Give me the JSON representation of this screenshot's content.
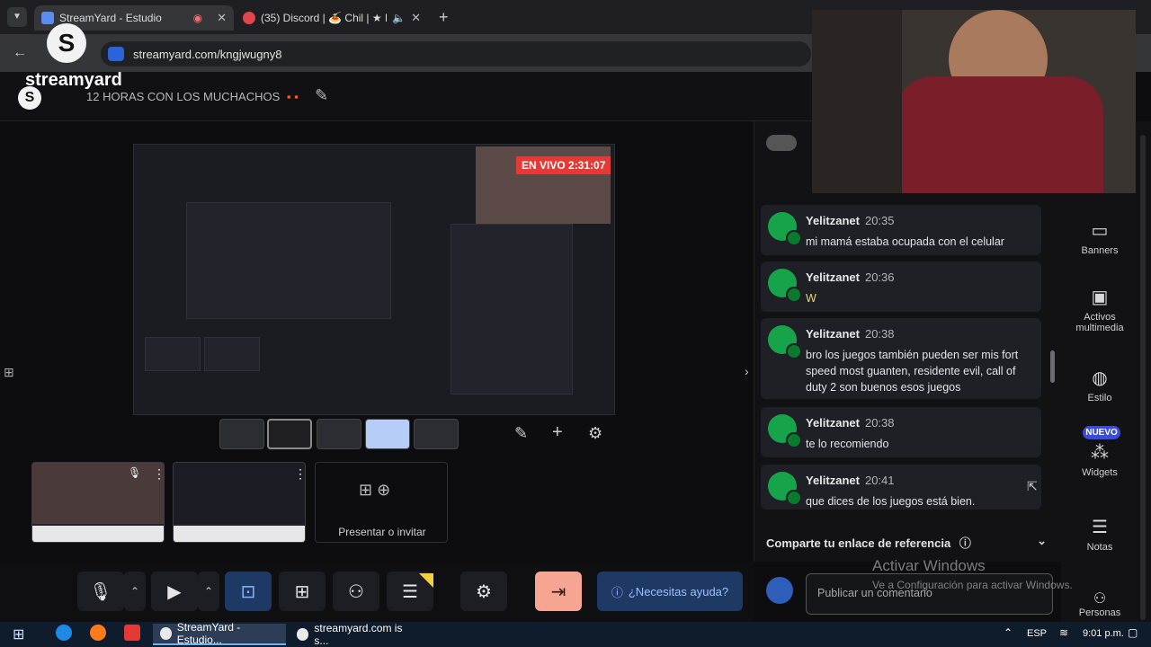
{
  "browser": {
    "tabs": [
      {
        "title": "StreamYard - Estudio",
        "active": true
      },
      {
        "title": "(35) Discord | 🍝 Chil | ★ H",
        "active": false
      }
    ],
    "url": "streamyard.com/kngjwugny8"
  },
  "app": {
    "logo": "streamyard",
    "broadcast_title": "12 HORAS CON LOS MUCHACHOS"
  },
  "stage": {
    "live_badge": "EN VIVO 2:31:07"
  },
  "present": {
    "label": "Presentar o invitar"
  },
  "chat": {
    "messages": [
      {
        "author": "Yelitzanet",
        "time": "20:35",
        "text": "mi mamá estaba ocupada con el celular"
      },
      {
        "author": "Yelitzanet",
        "time": "20:36",
        "text": "W"
      },
      {
        "author": "Yelitzanet",
        "time": "20:38",
        "text": "bro los juegos también pueden ser mis fort speed most guanten, residente evil, call of duty 2 son buenos esos juegos"
      },
      {
        "author": "Yelitzanet",
        "time": "20:38",
        "text": "te lo recomiendo"
      },
      {
        "author": "Yelitzanet",
        "time": "20:41",
        "text": "que dices de los juegos está bien."
      }
    ],
    "referral": "Comparte tu enlace de referencia",
    "comment_placeholder": "Publicar un comentario"
  },
  "rail": {
    "banners": "Banners",
    "media": "Activos multimedia",
    "style": "Estilo",
    "new_badge": "NUEVO",
    "widgets": "Widgets",
    "notes": "Notas",
    "people": "Personas"
  },
  "controls": {
    "help": "¿Necesitas ayuda?"
  },
  "watermark": {
    "line1": "Activar Windows",
    "line2": "Ve a Configuración para activar Windows."
  },
  "taskbar": {
    "items": [
      "StreamYard - Estudio...",
      "streamyard.com is s..."
    ],
    "lang": "ESP",
    "clock": "9:01 p.m."
  },
  "colors": {
    "accent_blue": "#1a73e8",
    "leave_button": "#f7a593",
    "help_button": "#1e3a64",
    "avatar_green": "#17a34a",
    "live_red": "#e53935"
  }
}
